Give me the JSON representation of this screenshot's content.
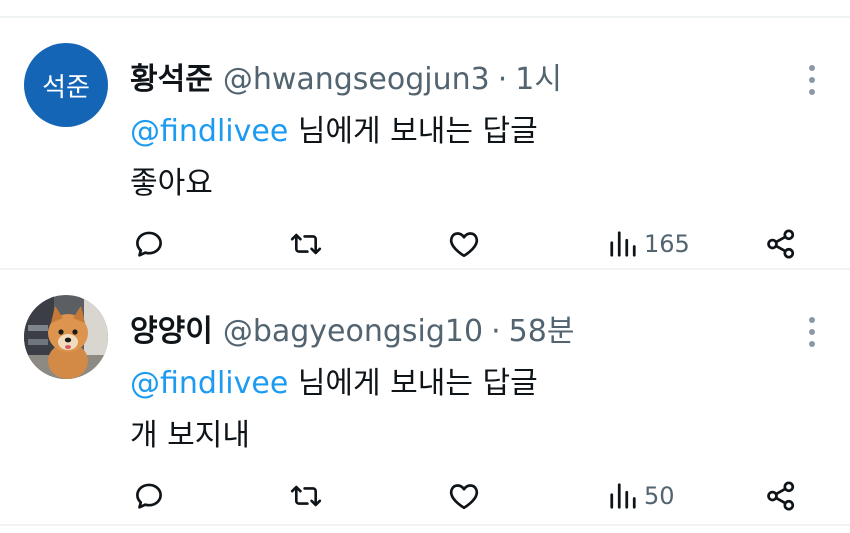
{
  "tweets": [
    {
      "avatar_text": "석준",
      "name": "황석준",
      "handle": "@hwangseogjun3",
      "separator": "·",
      "time": "1시",
      "reply_mention": "@findlivee",
      "reply_suffix": " 님에게 보내는 답글",
      "text": "좋아요",
      "views": "165"
    },
    {
      "avatar_icon": "dog-photo",
      "name": "양양이",
      "handle": "@bagyeongsig10",
      "separator": "·",
      "time": "58분",
      "reply_mention": "@findlivee",
      "reply_suffix": " 님에게 보내는 답글",
      "text": "개 보지내",
      "views": "50"
    }
  ],
  "icons": {
    "reply": "reply-icon",
    "retweet": "retweet-icon",
    "like": "heart-icon",
    "views": "views-icon",
    "share": "share-icon",
    "more": "more-vertical-icon"
  },
  "colors": {
    "link": "#1d9bf0",
    "secondary_text": "#536471",
    "avatar_bg": "#1565b7",
    "divider": "#eff3f4"
  }
}
